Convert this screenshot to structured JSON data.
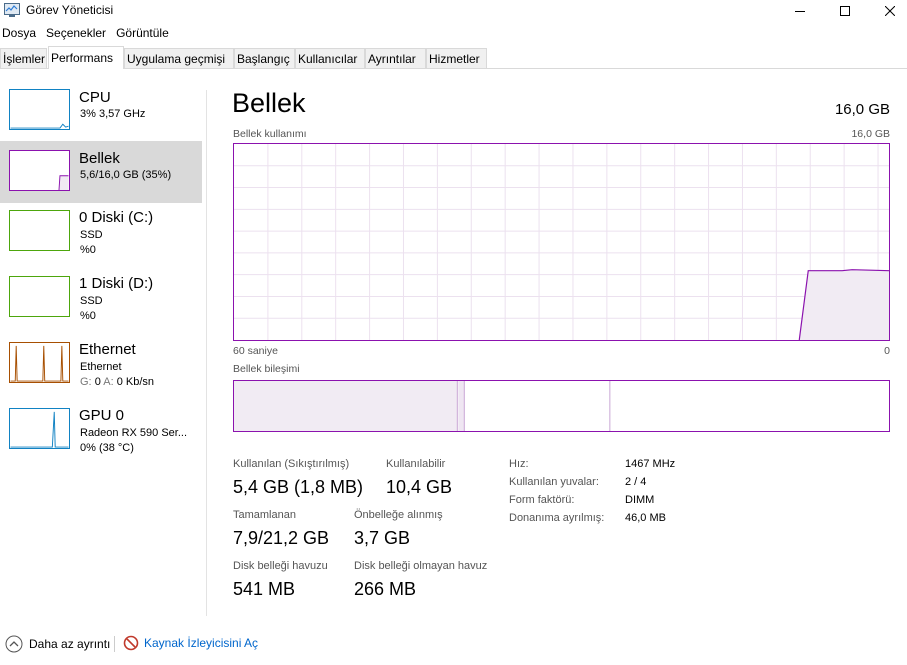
{
  "window": {
    "title": "Görev Yöneticisi",
    "colors": {
      "memory_accent": "#8b12ae",
      "cpu": "#1182c3",
      "disk": "#4da60c",
      "ethernet": "#a74f01",
      "gpu": "#1182c3",
      "selected_bg": "#d9d9d9"
    }
  },
  "menu": [
    "Dosya",
    "Seçenekler",
    "Görüntüle"
  ],
  "tabs": [
    "İşlemler",
    "Performans",
    "Uygulama geçmişi",
    "Başlangıç",
    "Kullanıcılar",
    "Ayrıntılar",
    "Hizmetler"
  ],
  "active_tab": "Performans",
  "sidebar": {
    "items": [
      {
        "title": "CPU",
        "lines": [
          "3%  3,57 GHz"
        ]
      },
      {
        "title": "Bellek",
        "lines": [
          "5,6/16,0 GB (35%)"
        ],
        "selected": true
      },
      {
        "title": "0 Diski (C:)",
        "lines": [
          "SSD",
          "%0"
        ]
      },
      {
        "title": "1 Diski (D:)",
        "lines": [
          "SSD",
          "%0"
        ]
      },
      {
        "title": "Ethernet",
        "lines": [
          "Ethernet"
        ],
        "extra": {
          "g_label": "G:",
          "g_value": "0",
          "a_label": "A:",
          "a_value": "0 Kb/sn"
        }
      },
      {
        "title": "GPU 0",
        "lines": [
          "Radeon RX 590 Ser...",
          "0%  (38 °C)"
        ]
      }
    ]
  },
  "main": {
    "title": "Bellek",
    "total": "16,0 GB",
    "usage_label": "Bellek kullanımı",
    "usage_max": "16,0 GB",
    "time_left": "60 saniye",
    "time_right": "0",
    "composition_label": "Bellek bileşimi",
    "stats": {
      "in_use_label": "Kullanılan (Sıkıştırılmış)",
      "in_use_value": "5,4 GB (1,8 MB)",
      "available_label": "Kullanılabilir",
      "available_value": "10,4 GB",
      "committed_label": "Tamamlanan",
      "committed_value": "7,9/21,2 GB",
      "cached_label": "Önbelleğe alınmış",
      "cached_value": "3,7 GB",
      "paged_label": "Disk belleği havuzu",
      "paged_value": "541 MB",
      "nonpaged_label": "Disk belleği olmayan havuz",
      "nonpaged_value": "266 MB"
    },
    "specs": [
      {
        "label": "Hız:",
        "value": "1467 MHz"
      },
      {
        "label": "Kullanılan yuvalar:",
        "value": "2 / 4"
      },
      {
        "label": "Form faktörü:",
        "value": "DIMM"
      },
      {
        "label": "Donanıma ayrılmış:",
        "value": "46,0 MB"
      }
    ]
  },
  "footer": {
    "fewer_details": "Daha az ayrıntı",
    "resource_monitor": "Kaynak İzleyicisini Aç"
  }
}
